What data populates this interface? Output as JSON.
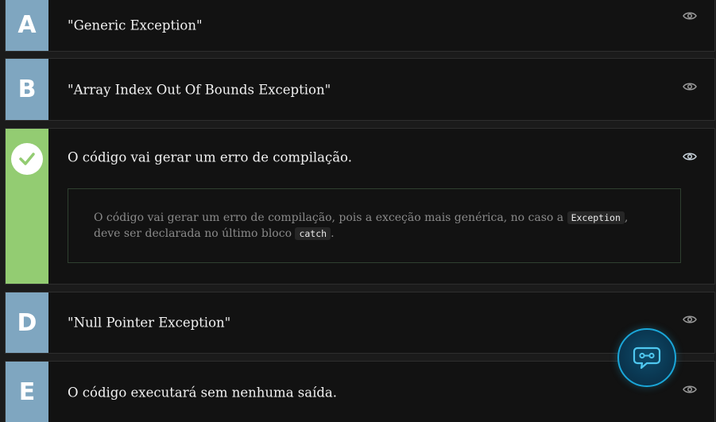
{
  "options": [
    {
      "letter": "A",
      "text": "\"Generic Exception\""
    },
    {
      "letter": "B",
      "text": "\"Array Index Out Of Bounds Exception\""
    },
    {
      "letter": "C",
      "text": "O código vai gerar um erro de compilação."
    },
    {
      "letter": "D",
      "text": "\"Null Pointer Exception\""
    },
    {
      "letter": "E",
      "text": "O código executará sem nenhuma saída."
    }
  ],
  "explanation": {
    "part1": "O código vai gerar um erro de compilação, pois a exceção mais genérica, no caso a ",
    "code1": "Exception",
    "part2": ", deve ser declarada no último bloco ",
    "code2": "catch",
    "part3": "."
  },
  "icons": {
    "eye": "eye-icon",
    "check": "check-icon",
    "assistant": "chat-assistant-icon"
  },
  "colors": {
    "letter_bg": "#7fa6c0",
    "correct_bg": "#93cc72",
    "fab_border": "#1aa6d8"
  }
}
